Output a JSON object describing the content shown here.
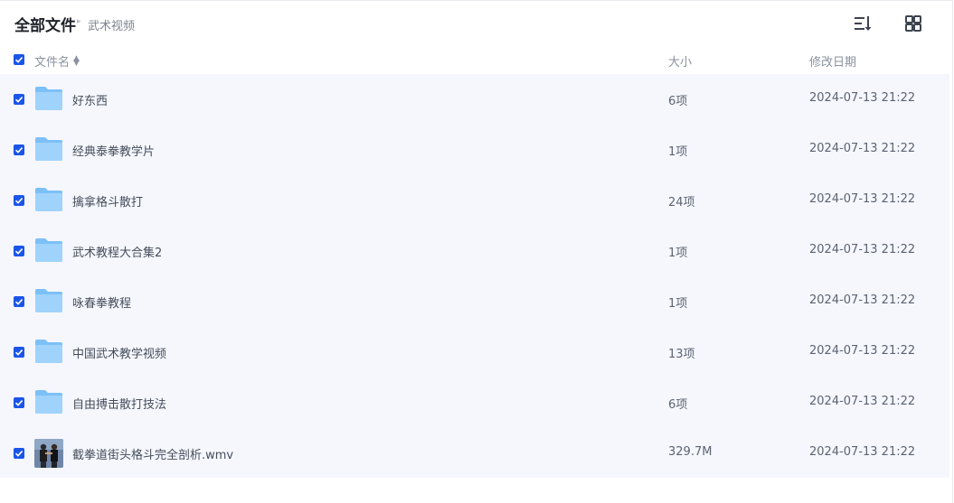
{
  "breadcrumb": {
    "root": "全部文件",
    "separator": "▸",
    "current": "武术视频"
  },
  "toolbar": {
    "sort_icon": "sort-list-icon",
    "view_icon": "grid-view-icon"
  },
  "columns": {
    "name": "文件名",
    "size": "大小",
    "date": "修改日期"
  },
  "colors": {
    "accent": "#1b55e8",
    "list_bg": "#f5f7fd",
    "folder": "#7cc0f7"
  },
  "files": [
    {
      "name": "好东西",
      "size": "6项",
      "date": "2024-07-13 21:22",
      "type": "folder",
      "checked": true
    },
    {
      "name": "经典泰拳教学片",
      "size": "1项",
      "date": "2024-07-13 21:22",
      "type": "folder",
      "checked": true
    },
    {
      "name": "擒拿格斗散打",
      "size": "24项",
      "date": "2024-07-13 21:22",
      "type": "folder",
      "checked": true
    },
    {
      "name": "武术教程大合集2",
      "size": "1项",
      "date": "2024-07-13 21:22",
      "type": "folder",
      "checked": true
    },
    {
      "name": "咏春拳教程",
      "size": "1项",
      "date": "2024-07-13 21:22",
      "type": "folder",
      "checked": true
    },
    {
      "name": "中国武术教学视频",
      "size": "13项",
      "date": "2024-07-13 21:22",
      "type": "folder",
      "checked": true
    },
    {
      "name": "自由搏击散打技法",
      "size": "6项",
      "date": "2024-07-13 21:22",
      "type": "folder",
      "checked": true
    },
    {
      "name": "截拳道街头格斗完全剖析.wmv",
      "size": "329.7M",
      "date": "2024-07-13 21:22",
      "type": "video",
      "checked": true
    }
  ]
}
